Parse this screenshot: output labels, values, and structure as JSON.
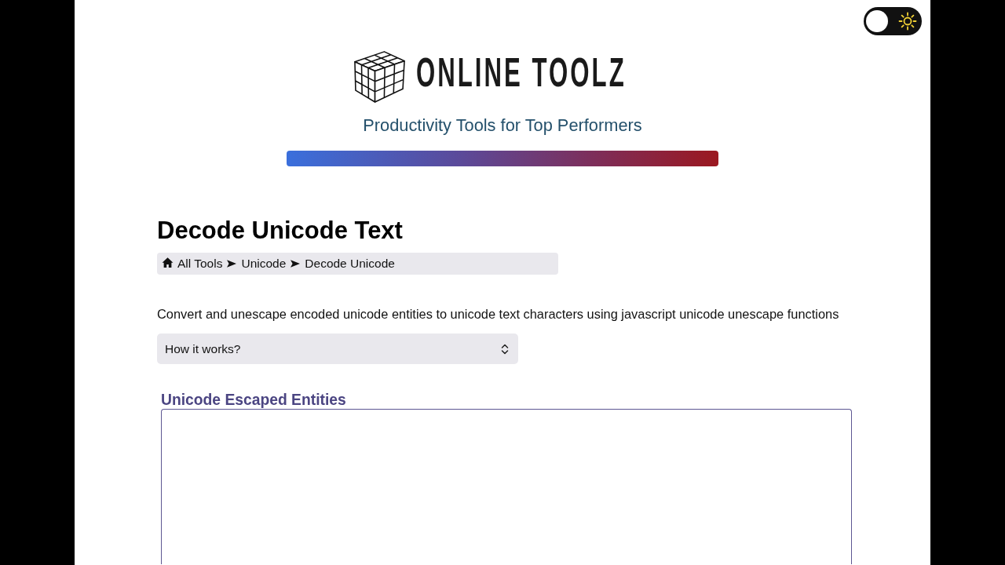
{
  "theme_toggle": {
    "on": false
  },
  "brand": {
    "name": "ONLINE TOOLZ",
    "tagline": "Productivity Tools for Top Performers"
  },
  "page": {
    "title": "Decode Unicode Text",
    "breadcrumb": [
      "All Tools",
      "Unicode",
      "Decode Unicode"
    ],
    "description": "Convert and unescape encoded unicode entities to unicode text characters using javascript unicode unescape functions"
  },
  "how_it_works": {
    "label": "How it works?"
  },
  "input": {
    "label": "Unicode Escaped Entities"
  }
}
